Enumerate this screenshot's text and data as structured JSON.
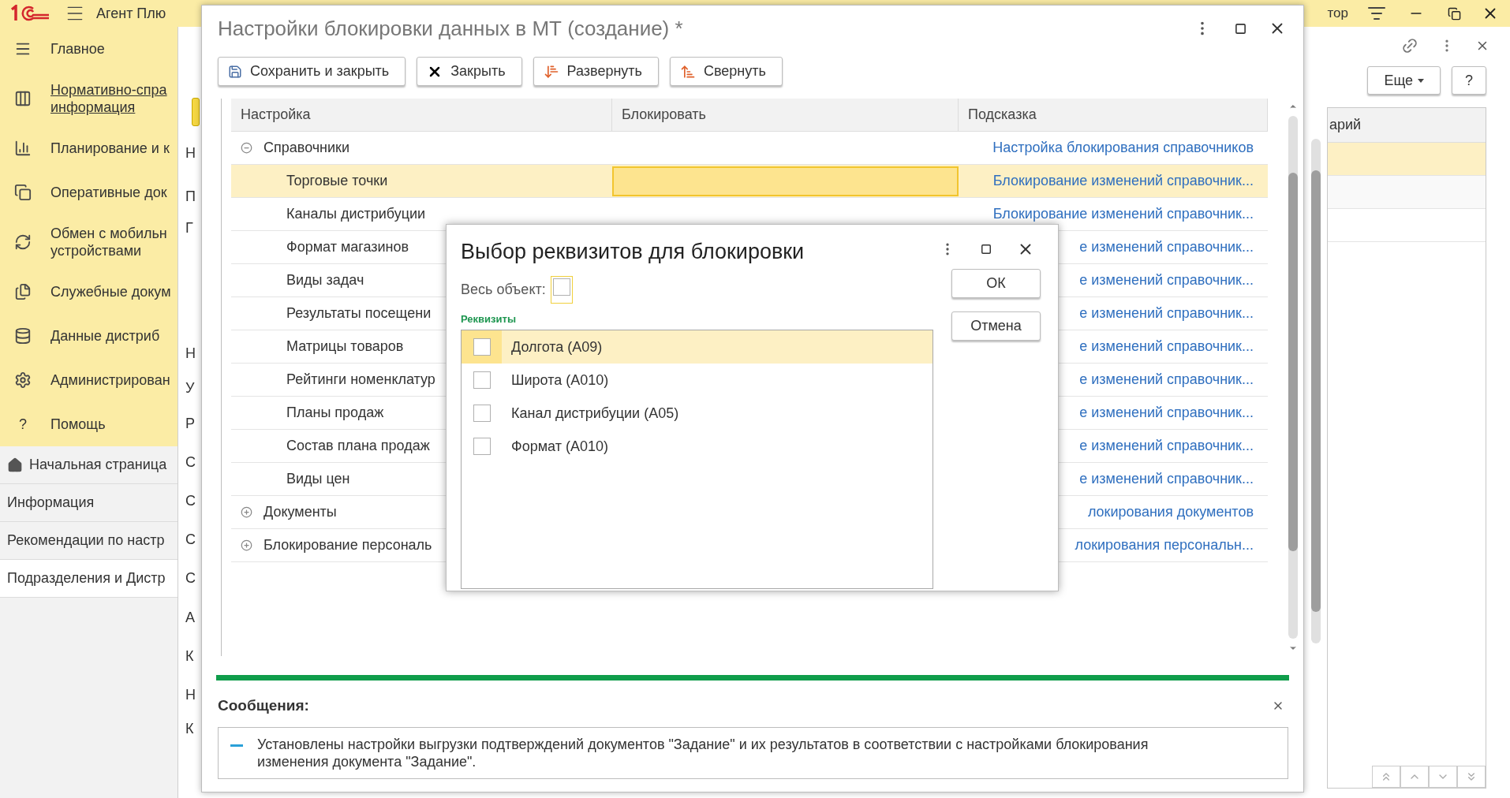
{
  "top_bar": {
    "app_name": "Агент Плю",
    "user": "тор"
  },
  "sidebar": {
    "items": [
      {
        "lines": [
          "Главное"
        ],
        "selected": false
      },
      {
        "lines": [
          "Нормативно-спра",
          "информация"
        ],
        "selected": true
      },
      {
        "lines": [
          "Планирование и к"
        ],
        "selected": false
      },
      {
        "lines": [
          "Оперативные док"
        ],
        "selected": false
      },
      {
        "lines": [
          "Обмен с мобильн",
          "устройствами"
        ],
        "selected": false
      },
      {
        "lines": [
          "Служебные докум"
        ],
        "selected": false
      },
      {
        "lines": [
          "Данные дистриб"
        ],
        "selected": false
      },
      {
        "lines": [
          "Администрирован"
        ],
        "selected": false
      },
      {
        "lines": [
          "Помощь"
        ],
        "selected": false,
        "icon_char": "?"
      }
    ],
    "open_windows": [
      {
        "label": "Начальная страница",
        "kind": "home",
        "selected": false
      },
      {
        "label": "Информация",
        "kind": "plain",
        "selected": false
      },
      {
        "label": "Рекомендации по настр",
        "kind": "plain",
        "selected": false
      },
      {
        "label": "Подразделения и Дистр",
        "kind": "plain",
        "selected": true
      }
    ]
  },
  "background_form": {
    "cut_labels": [
      "Н",
      "П",
      "Г",
      "Н",
      "У",
      "Р",
      "С",
      "С",
      "С",
      "С",
      "А",
      "К",
      "Н",
      "К"
    ],
    "buttons": [
      "Еще",
      "?"
    ],
    "column_header": "арий",
    "rows": [
      {
        "selected": true
      },
      {
        "selected": false
      },
      {
        "selected": false
      }
    ]
  },
  "form": {
    "title": "Настройки блокировки данных в МТ (создание) *",
    "toolbar": [
      {
        "label": "Сохранить и закрыть",
        "kind": "save"
      },
      {
        "label": "Закрыть",
        "kind": "close"
      },
      {
        "label": "Развернуть",
        "kind": "expand"
      },
      {
        "label": "Свернуть",
        "kind": "collapse"
      }
    ],
    "columns": [
      "Настройка",
      "Блокировать",
      "Подсказка"
    ],
    "rows": [
      {
        "setting": "Справочники",
        "expanded": true,
        "hint": "Настройка блокирования справочников",
        "children": [
          {
            "setting": "Торговые точки",
            "hint": "Блокирование изменений справочник...",
            "selected": true
          },
          {
            "setting": "Каналы дистрибуции",
            "hint": "Блокирование изменений справочник...",
            "selected": false
          },
          {
            "setting": "Формат магазинов",
            "hint": "е изменений справочник...",
            "selected": false
          },
          {
            "setting": "Виды задач",
            "hint": "е изменений справочник...",
            "selected": false
          },
          {
            "setting": "Результаты посещени",
            "hint": "е изменений справочник...",
            "selected": false
          },
          {
            "setting": "Матрицы товаров",
            "hint": "е изменений справочник...",
            "selected": false
          },
          {
            "setting": "Рейтинги номенклатур",
            "hint": "е изменений справочник...",
            "selected": false
          },
          {
            "setting": "Планы продаж",
            "hint": "е изменений справочник...",
            "selected": false
          },
          {
            "setting": "Состав плана продаж",
            "hint": "е изменений справочник...",
            "selected": false
          },
          {
            "setting": "Виды цен",
            "hint": "е изменений справочник...",
            "selected": false
          }
        ]
      },
      {
        "setting": "Документы",
        "expanded": false,
        "hint": "локирования документов",
        "children": []
      },
      {
        "setting": "Блокирование персональ",
        "expanded": false,
        "hint": "локирования персональн...",
        "children": []
      }
    ],
    "messages": {
      "title": "Сообщения:",
      "items": [
        "Установлены настройки выгрузки подтверждений документов \"Задание\" и их результатов в соответствии с настройками блокирования изменения документа \"Задание\"."
      ]
    }
  },
  "dialog": {
    "title": "Выбор реквизитов для блокировки",
    "whole_object": {
      "label": "Весь объект:",
      "checked": false
    },
    "group_label": "Реквизиты",
    "attributes": [
      {
        "label": "Долгота (А09)",
        "checked": false,
        "selected": true
      },
      {
        "label": "Широта (А010)",
        "checked": false,
        "selected": false
      },
      {
        "label": "Канал дистрибуции (А05)",
        "checked": false,
        "selected": false
      },
      {
        "label": "Формат (А010)",
        "checked": false,
        "selected": false
      }
    ],
    "buttons": [
      "ОК",
      "Отмена"
    ]
  }
}
